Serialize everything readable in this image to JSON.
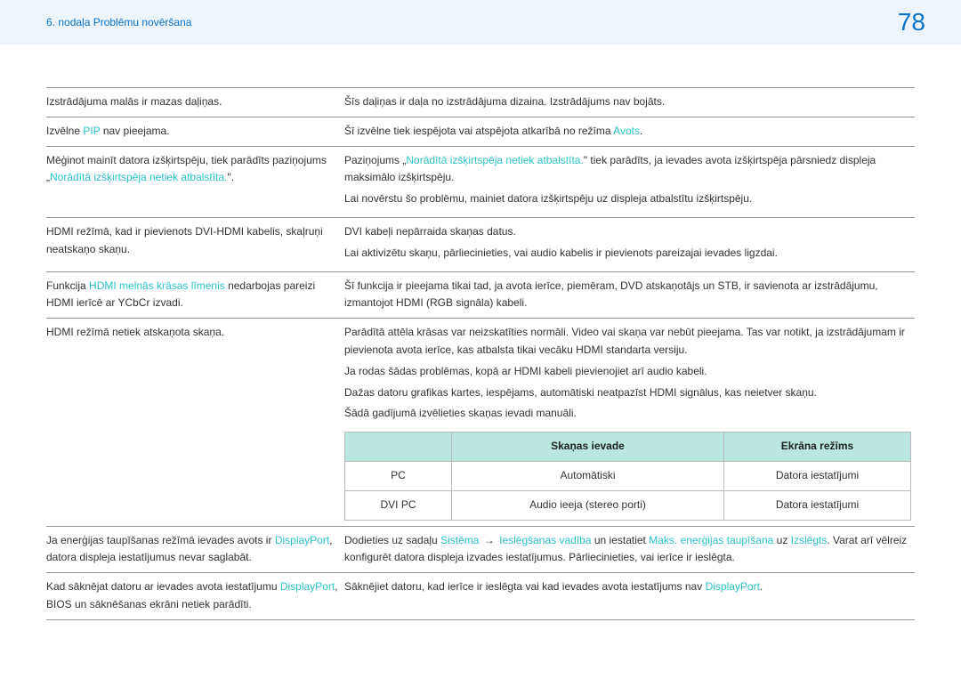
{
  "header": {
    "chapter": "6. nodaļa Problēmu novēršana",
    "page": "78"
  },
  "rows": [
    {
      "left_parts": [
        {
          "t": "Izstrādājuma malās ir mazas daļiņas."
        }
      ],
      "right_parts": [
        {
          "t": "Šīs daļiņas ir daļa no izstrādājuma dizaina. Izstrādājums nav bojāts."
        }
      ]
    },
    {
      "left_parts": [
        {
          "t": "Izvēlne "
        },
        {
          "t": "PIP",
          "c": "link"
        },
        {
          "t": " nav pieejama."
        }
      ],
      "right_parts": [
        {
          "t": "Šī izvēlne tiek iespējota vai atspējota atkarībā no režīma "
        },
        {
          "t": "Avots",
          "c": "link"
        },
        {
          "t": "."
        }
      ]
    },
    {
      "left_parts": [
        {
          "t": "Mēģinot mainīt datora izšķirtspēju, tiek parādīts paziņojums „"
        },
        {
          "t": "Norādītā izšķirtspēja netiek atbalstīta.",
          "c": "link"
        },
        {
          "t": "\"."
        }
      ],
      "right_paras": [
        [
          {
            "t": "Paziņojums „"
          },
          {
            "t": "Norādītā izšķirtspēja netiek atbalstīta.",
            "c": "link"
          },
          {
            "t": "\" tiek parādīts, ja ievades avota izšķirtspēja pārsniedz displeja maksimālo izšķirtspēju."
          }
        ],
        [
          {
            "t": "Lai novērstu šo problēmu, mainiet datora izšķirtspēju uz displeja atbalstītu izšķirtspēju."
          }
        ]
      ]
    },
    {
      "left_parts": [
        {
          "t": "HDMI režīmā, kad ir pievienots DVI-HDMI kabelis, skaļruņi neatskaņo skaņu."
        }
      ],
      "right_paras": [
        [
          {
            "t": "DVI kabeļi nepārraida skaņas datus."
          }
        ],
        [
          {
            "t": "Lai aktivizētu skaņu, pārliecinieties, vai audio kabelis ir pievienots pareizajai ievades ligzdai."
          }
        ]
      ]
    },
    {
      "left_parts": [
        {
          "t": "Funkcija "
        },
        {
          "t": "HDMI melnās krāsas līmenis",
          "c": "link"
        },
        {
          "t": " nedarbojas pareizi HDMI ierīcē ar YCbCr izvadi."
        }
      ],
      "right_parts": [
        {
          "t": "Šī funkcija ir pieejama tikai tad, ja avota ierīce, piemēram, DVD atskaņotājs un STB, ir savienota ar izstrādājumu, izmantojot HDMI (RGB signāla) kabeli."
        }
      ]
    },
    {
      "left_parts": [
        {
          "t": "HDMI režīmā netiek atskaņota skaņa."
        }
      ],
      "right_paras": [
        [
          {
            "t": "Parādītā attēla krāsas var neizskatīties normāli. Video vai skaņa var nebūt pieejama. Tas var notikt, ja izstrādājumam ir pievienota avota ierīce, kas atbalsta tikai vecāku HDMI standarta versiju."
          }
        ],
        [
          {
            "t": "Ja rodas šādas problēmas, kopā ar HDMI kabeli pievienojiet arī audio kabeli."
          }
        ],
        [
          {
            "t": "Dažas datoru grafikas kartes, iespējams, automātiski neatpazīst HDMI signālus, kas neietver skaņu."
          }
        ],
        [
          {
            "t": "Šādā gadījumā izvēlieties skaņas ievadi manuāli."
          }
        ]
      ],
      "has_inner_table": true
    },
    {
      "left_parts": [
        {
          "t": "Ja enerģijas taupīšanas režīmā ievades avots ir "
        },
        {
          "t": "DisplayPort",
          "c": "link"
        },
        {
          "t": ", datora displeja iestatījumus nevar saglabāt."
        }
      ],
      "right_parts": [
        {
          "t": "Dodieties uz sadaļu "
        },
        {
          "t": "Sistēma",
          "c": "link"
        },
        {
          "t": " → ",
          "c": "arrow"
        },
        {
          "t": "Ieslēgšanas vadība",
          "c": "link"
        },
        {
          "t": " un iestatiet "
        },
        {
          "t": "Maks. enerģijas taupīšana",
          "c": "link"
        },
        {
          "t": " uz "
        },
        {
          "t": "Izslēgts",
          "c": "link"
        },
        {
          "t": ". Varat arī vēlreiz konfigurēt datora displeja izvades iestatījumus. Pārliecinieties, vai ierīce ir ieslēgta."
        }
      ]
    },
    {
      "left_parts": [
        {
          "t": "Kad sāknējat datoru ar ievades avota iestatījumu "
        },
        {
          "t": "DisplayPort",
          "c": "link"
        },
        {
          "t": ", BIOS un sāknēšanas ekrāni netiek parādīti."
        }
      ],
      "right_parts": [
        {
          "t": "Sāknējiet datoru, kad ierīce ir ieslēgta vai kad ievades avota iestatījums nav "
        },
        {
          "t": "DisplayPort",
          "c": "link"
        },
        {
          "t": "."
        }
      ]
    }
  ],
  "inner_table": {
    "head_blank": "",
    "head_sound": "Skaņas ievade",
    "head_mode": "Ekrāna režīms",
    "r1_label": "PC",
    "r1_sound": "Automātiski",
    "r1_mode": "Datora iestatījumi",
    "r2_label": "DVI PC",
    "r2_sound": "Audio ieeja (stereo porti)",
    "r2_mode": "Datora iestatījumi"
  }
}
